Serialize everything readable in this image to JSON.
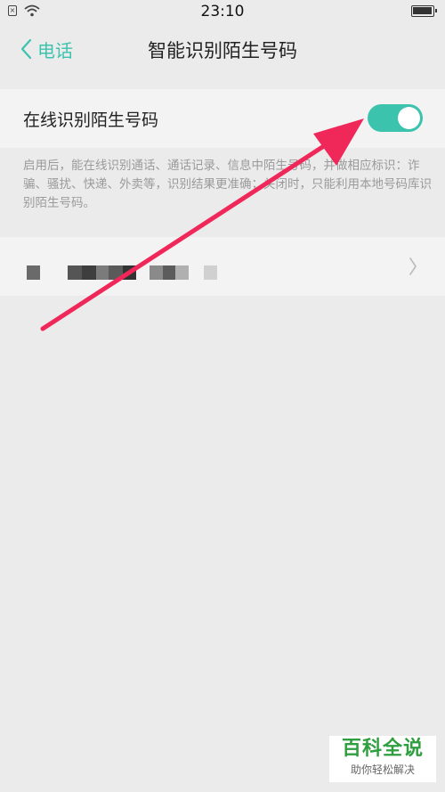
{
  "status_bar": {
    "time": "23:10",
    "sim_icon": "sim-card-icon",
    "wifi_icon": "wifi-icon",
    "battery_icon": "battery-icon"
  },
  "header": {
    "back_label": "电话",
    "title": "智能识别陌生号码",
    "back_icon": "chevron-left-icon"
  },
  "settings": {
    "online_identify": {
      "label": "在线识别陌生号码",
      "enabled": true
    },
    "description": "启用后，能在线识别通话、通话记录、信息中陌生号码，并做相应标识：诈骗、骚扰、快递、外卖等，识别结果更准确；关闭时，只能利用本地号码库识别陌生号码。",
    "number_row": {
      "value": "(pixelated)",
      "chevron_icon": "chevron-right-icon"
    }
  },
  "overlay": {
    "arrow_color": "#f0285a"
  },
  "watermark": {
    "brand": "百科全说",
    "slogan": "助你轻松解决"
  },
  "colors": {
    "accent": "#3cc3ad",
    "background": "#ebebeb",
    "card": "#f3f3f3"
  }
}
